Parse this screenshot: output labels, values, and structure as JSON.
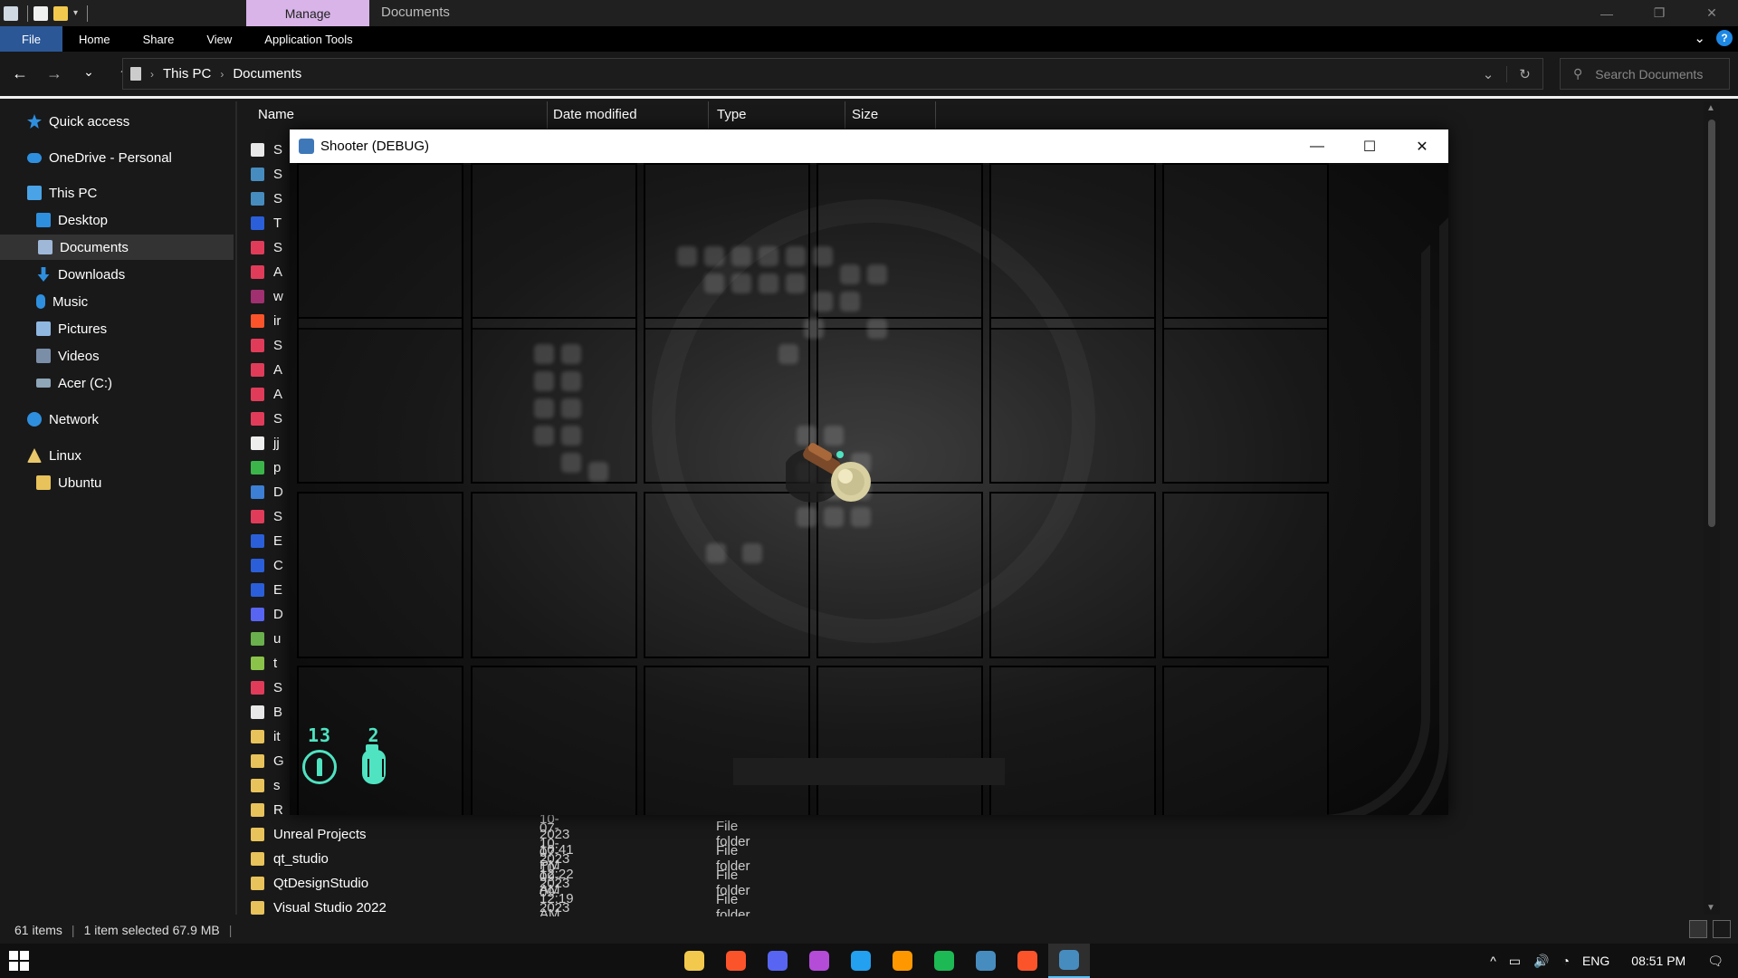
{
  "titlebar": {
    "manage_tab": "Manage",
    "window_title": "Documents",
    "minimize": "—",
    "restore": "❐",
    "close": "✕"
  },
  "ribbon": {
    "tabs": [
      "File",
      "Home",
      "Share",
      "View",
      "Application Tools"
    ],
    "help": "?",
    "expand": "⌄"
  },
  "nav": {
    "back": "←",
    "forward": "→",
    "recent": "⌄",
    "up": "↑"
  },
  "address": {
    "crumbs": [
      "This PC",
      "Documents"
    ],
    "dropdown": "⌄",
    "refresh": "↻"
  },
  "search": {
    "placeholder": "Search Documents",
    "icon": "⚲"
  },
  "sidebar": {
    "items": [
      {
        "label": "Quick access",
        "icon": "star-icon",
        "color": "#2f8fdf"
      },
      {
        "label": "OneDrive - Personal",
        "icon": "cloud-icon",
        "color": "#2f8fdf"
      },
      {
        "label": "This PC",
        "icon": "computer-icon",
        "color": "#4aa3e6"
      },
      {
        "label": "Desktop",
        "icon": "desktop-icon",
        "color": "#2f8fdf"
      },
      {
        "label": "Documents",
        "icon": "document-icon",
        "color": "#9fb8d8"
      },
      {
        "label": "Downloads",
        "icon": "download-icon",
        "color": "#2f8fdf"
      },
      {
        "label": "Music",
        "icon": "music-icon",
        "color": "#2f8fdf"
      },
      {
        "label": "Pictures",
        "icon": "pictures-icon",
        "color": "#8fb7e0"
      },
      {
        "label": "Videos",
        "icon": "videos-icon",
        "color": "#7a8ea8"
      },
      {
        "label": "Acer (C:)",
        "icon": "drive-icon",
        "color": "#8fa5b8"
      },
      {
        "label": "Network",
        "icon": "network-icon",
        "color": "#2f8fdf"
      },
      {
        "label": "Linux",
        "icon": "linux-icon",
        "color": "#e8c86a"
      },
      {
        "label": "Ubuntu",
        "icon": "folder-icon",
        "color": "#e8c25a"
      }
    ]
  },
  "columns": {
    "name": "Name",
    "date_modified": "Date modified",
    "type": "Type",
    "size": "Size"
  },
  "files": [
    {
      "name": "S",
      "icon": "text-file-icon",
      "color": "#e8e8e8"
    },
    {
      "name": "S",
      "icon": "godot-icon",
      "color": "#478cbf"
    },
    {
      "name": "S",
      "icon": "godot-icon",
      "color": "#478cbf"
    },
    {
      "name": "T",
      "icon": "word-icon",
      "color": "#2b5fd9"
    },
    {
      "name": "S",
      "icon": "app-icon",
      "color": "#e03c5a"
    },
    {
      "name": "A",
      "icon": "app-icon",
      "color": "#e03c5a"
    },
    {
      "name": "w",
      "icon": "archive-icon",
      "color": "#a03070"
    },
    {
      "name": "ir",
      "icon": "brave-icon",
      "color": "#fb542b"
    },
    {
      "name": "S",
      "icon": "app-icon",
      "color": "#e03c5a"
    },
    {
      "name": "A",
      "icon": "app-icon",
      "color": "#e03c5a"
    },
    {
      "name": "A",
      "icon": "app-icon",
      "color": "#e03c5a"
    },
    {
      "name": "S",
      "icon": "app-icon",
      "color": "#e03c5a"
    },
    {
      "name": "jj",
      "icon": "html-icon",
      "color": "#eeeeee"
    },
    {
      "name": "p",
      "icon": "green-app-icon",
      "color": "#3bb54a"
    },
    {
      "name": "D",
      "icon": "shortcut-icon",
      "color": "#3c7fd4"
    },
    {
      "name": "S",
      "icon": "app-icon",
      "color": "#e03c5a"
    },
    {
      "name": "E",
      "icon": "word-icon",
      "color": "#2b5fd9"
    },
    {
      "name": "C",
      "icon": "word-icon",
      "color": "#2b5fd9"
    },
    {
      "name": "E",
      "icon": "word-icon",
      "color": "#2b5fd9"
    },
    {
      "name": "D",
      "icon": "discord-icon",
      "color": "#5865f2"
    },
    {
      "name": "u",
      "icon": "globe-icon",
      "color": "#6ab04c"
    },
    {
      "name": "t",
      "icon": "potion-icon",
      "color": "#8bc34a"
    },
    {
      "name": "S",
      "icon": "app-icon",
      "color": "#e03c5a"
    },
    {
      "name": "B",
      "icon": "text-file-icon",
      "color": "#e8e8e8"
    },
    {
      "name": "it",
      "icon": "folder-icon",
      "color": "#e8c25a"
    },
    {
      "name": "G",
      "icon": "folder-icon",
      "color": "#e8c25a"
    },
    {
      "name": "s",
      "icon": "folder-icon",
      "color": "#e8c25a"
    },
    {
      "name": "R",
      "icon": "folder-icon",
      "color": "#e8c25a"
    },
    {
      "name": "Unreal Projects",
      "date": "20-10-2023 10:41 PM",
      "type": "File folder",
      "icon": "folder-icon",
      "color": "#e8c25a"
    },
    {
      "name": "qt_studio",
      "date": "07-10-2023 12:22 AM",
      "type": "File folder",
      "icon": "folder-icon",
      "color": "#e8c25a"
    },
    {
      "name": "QtDesignStudio",
      "date": "07-10-2023 12:19 AM",
      "type": "File folder",
      "icon": "folder-icon",
      "color": "#e8c25a"
    },
    {
      "name": "Visual Studio 2022",
      "date": "09-09-2023 05:13 PM",
      "type": "File folder",
      "icon": "folder-icon",
      "color": "#e8c25a"
    }
  ],
  "status": {
    "items": "61 items",
    "selected": "1 item selected  67.9 MB"
  },
  "game": {
    "title": "Shooter (DEBUG)",
    "minimize": "—",
    "maximize": "☐",
    "close": "✕",
    "ammo": "13",
    "grenades": "2"
  },
  "taskbar": {
    "apps": [
      {
        "name": "file-explorer",
        "color": "#f2c94c"
      },
      {
        "name": "brave",
        "color": "#fb542b"
      },
      {
        "name": "discord",
        "color": "#5865f2"
      },
      {
        "name": "app-purple",
        "color": "#b44cd8"
      },
      {
        "name": "vscode",
        "color": "#23a0f0"
      },
      {
        "name": "sublime",
        "color": "#ff9800"
      },
      {
        "name": "spotify",
        "color": "#1db954"
      },
      {
        "name": "godot",
        "color": "#478cbf"
      },
      {
        "name": "brave-2",
        "color": "#fb542b"
      },
      {
        "name": "godot-game",
        "color": "#478cbf"
      }
    ],
    "tray": {
      "chevron": "^",
      "battery": "▭",
      "volume": "🔊",
      "wifi": "◔",
      "language": "ENG",
      "time": "08:51 PM",
      "notifications": "🗨"
    }
  }
}
